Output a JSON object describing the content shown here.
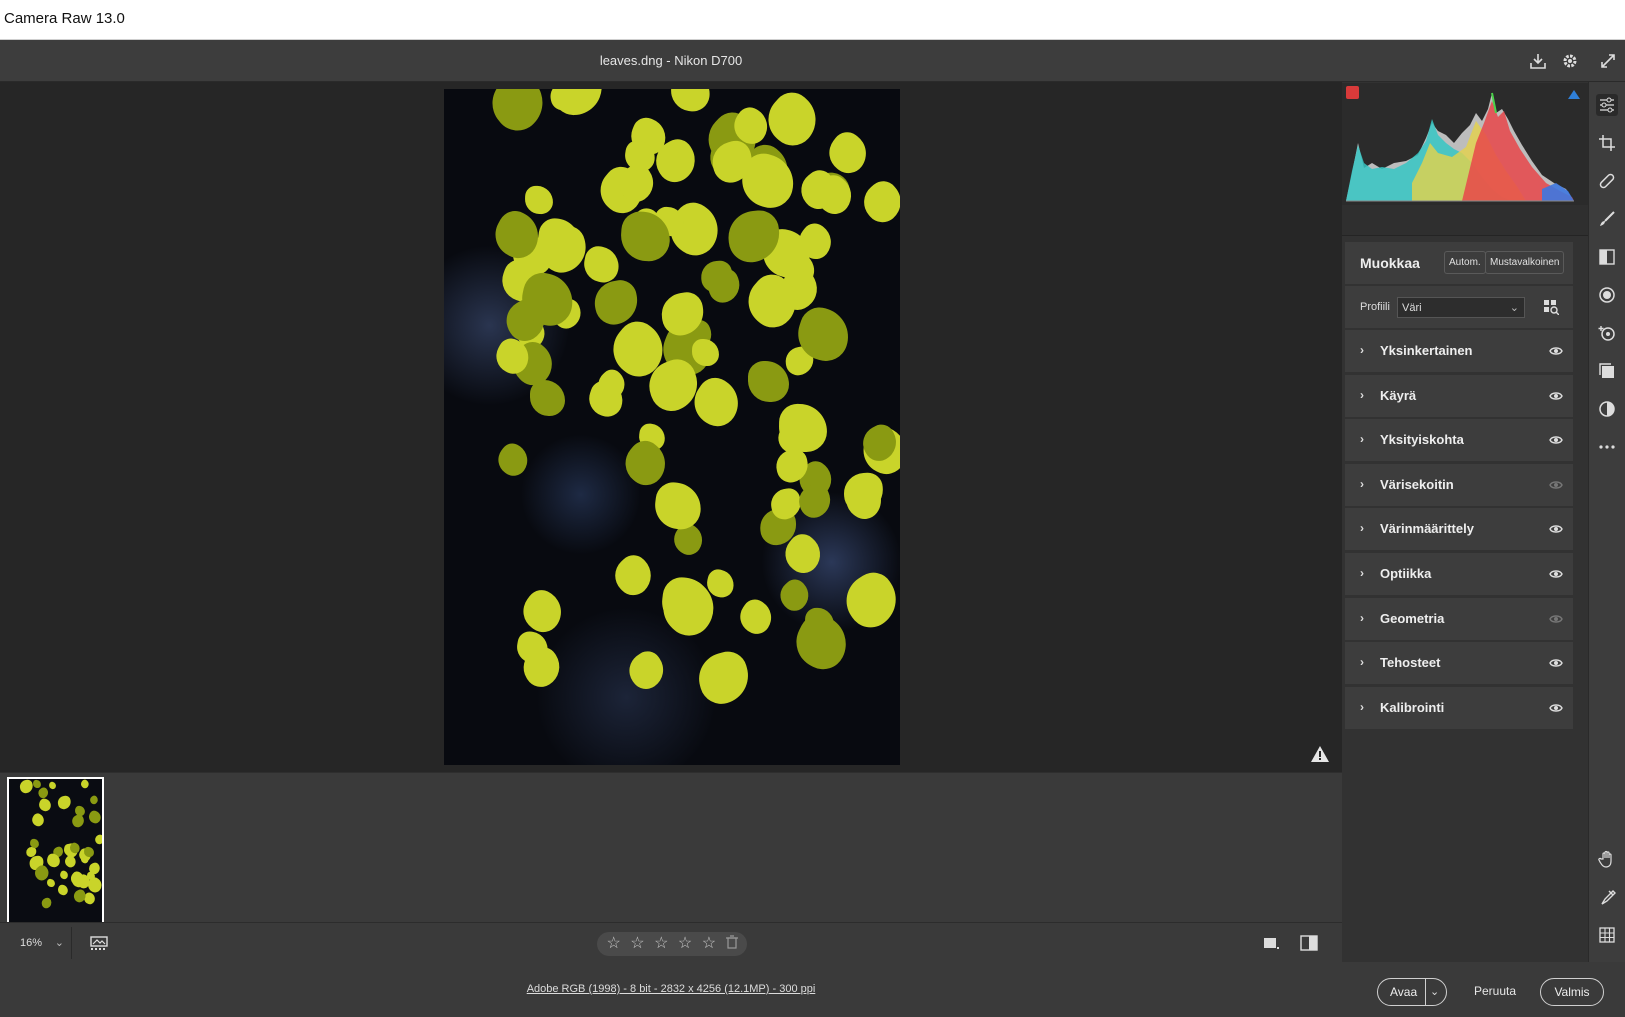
{
  "window": {
    "title": "Camera Raw 13.0"
  },
  "header": {
    "file_title": "leaves.dng  -  Nikon D700"
  },
  "toolbar": {
    "zoom": "16%",
    "stars": [
      "☆",
      "☆",
      "☆",
      "☆",
      "☆"
    ]
  },
  "status": {
    "info": "Adobe RGB (1998) - 8 bit - 2832 x 4256 (12.1MP) - 300 ppi"
  },
  "edit": {
    "title": "Muokkaa",
    "auto_label": "Autom.",
    "bw_label": "Mustavalkoinen",
    "profile_label": "Profiili",
    "profile_value": "Väri"
  },
  "sections": [
    {
      "label": "Yksinkertainen"
    },
    {
      "label": "Käyrä"
    },
    {
      "label": "Yksityiskohta"
    },
    {
      "label": "Värisekoitin"
    },
    {
      "label": "Värinmäärittely"
    },
    {
      "label": "Optiikka"
    },
    {
      "label": "Geometria"
    },
    {
      "label": "Tehosteet"
    },
    {
      "label": "Kalibrointi"
    }
  ],
  "buttons": {
    "open": "Avaa",
    "cancel": "Peruuta",
    "done": "Valmis"
  },
  "colors": {
    "leaf": "#c9d42a",
    "leaf_dark": "#8a9a12",
    "panel": "#3d3d3d",
    "canvas": "#262626"
  }
}
